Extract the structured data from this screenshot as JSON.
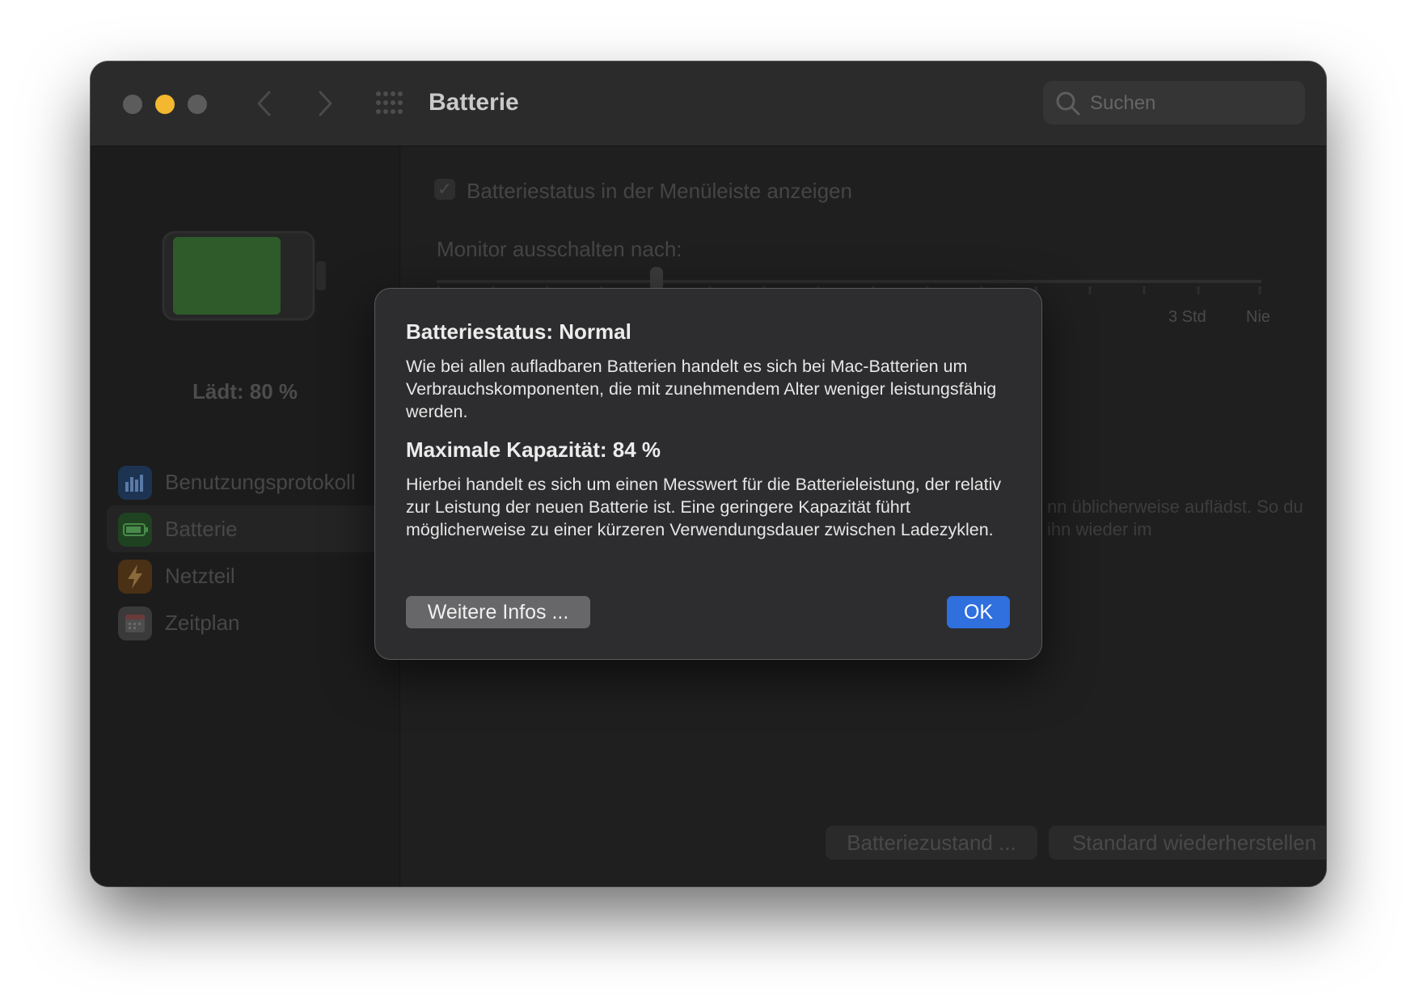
{
  "window": {
    "title": "Batterie",
    "search": {
      "placeholder": "Suchen"
    }
  },
  "sidebar": {
    "charge_status": "Lädt: 80 %",
    "battery_level": 0.8,
    "items": [
      {
        "label": "Benutzungsprotokoll",
        "icon": "bar-chart-icon",
        "color": "#2b5fa5"
      },
      {
        "label": "Batterie",
        "icon": "battery-icon",
        "color": "#2f8a38",
        "active": true
      },
      {
        "label": "Netzteil",
        "icon": "bolt-icon",
        "color": "#b8741c"
      },
      {
        "label": "Zeitplan",
        "icon": "calendar-icon",
        "color": "#8e8e8e"
      }
    ]
  },
  "main": {
    "show_menubar_label": "Batteriestatus in der Menüleiste anzeigen",
    "show_menubar_checked": true,
    "monitor_off_label": "Monitor ausschalten nach:",
    "slider_ticks": [
      "3 Std",
      "Nie"
    ],
    "background_text": "nn üblicherweise auflädst. So du ihn wieder im",
    "buttons": {
      "battery_health": "Batteriezustand ...",
      "restore_defaults": "Standard wiederherstellen",
      "help": "?"
    }
  },
  "dialog": {
    "heading_status": "Batteriestatus: Normal",
    "text_status": "Wie bei allen aufladbaren Batterien handelt es sich bei Mac-Batterien um Verbrauchskomponenten, die mit zunehmendem Alter weniger leistungsfähig werden.",
    "heading_capacity": "Maximale Kapazität: 84 %",
    "text_capacity": "Hierbei handelt es sich um einen Messwert für die Batterieleistung, der relativ zur Leistung der neuen Batterie ist. Eine geringere Kapazität führt möglicherweise zu einer kürzeren Verwendungsdauer zwischen Ladezyklen.",
    "more_info_label": "Weitere Infos ...",
    "ok_label": "OK"
  },
  "colors": {
    "accent": "#2f6fde",
    "minimize": "#f3b82f",
    "battery_fill": "#2f5a29"
  }
}
